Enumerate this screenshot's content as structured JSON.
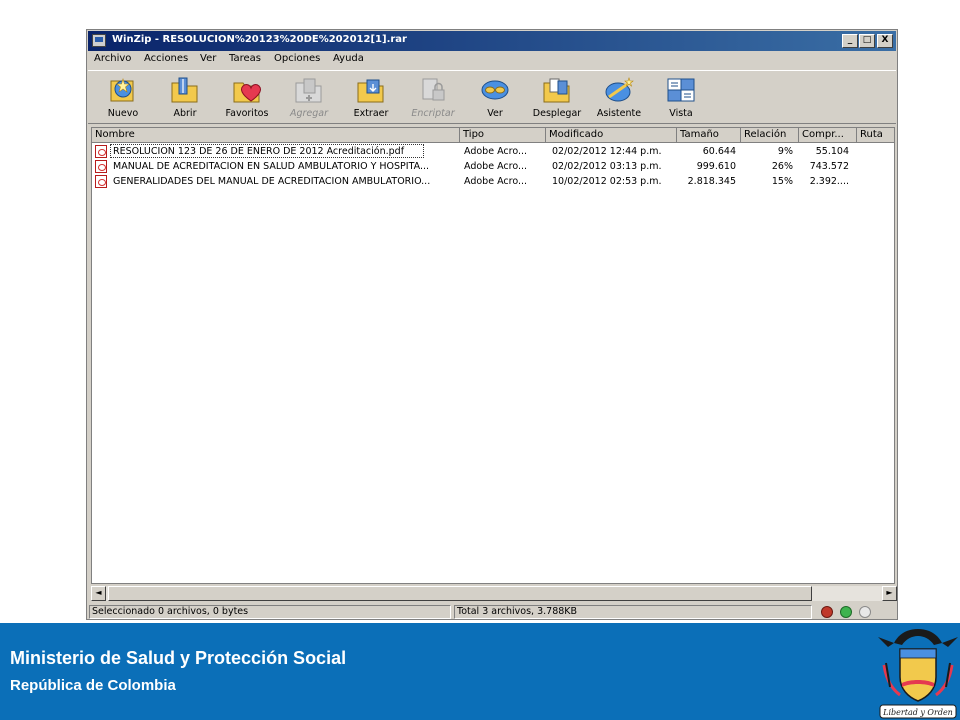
{
  "window": {
    "title": "WinZip - RESOLUCION%20123%20DE%202012[1].rar",
    "controls": {
      "minimize": "_",
      "maximize": "□",
      "close": "X"
    }
  },
  "menu": [
    "Archivo",
    "Acciones",
    "Ver",
    "Tareas",
    "Opciones",
    "Ayuda"
  ],
  "toolbar": [
    {
      "label": "Nuevo",
      "icon": "new-archive-icon",
      "enabled": true
    },
    {
      "label": "Abrir",
      "icon": "open-folder-icon",
      "enabled": true
    },
    {
      "label": "Favoritos",
      "icon": "favorites-heart-icon",
      "enabled": true
    },
    {
      "label": "Agregar",
      "icon": "add-files-icon",
      "enabled": false
    },
    {
      "label": "Extraer",
      "icon": "extract-icon",
      "enabled": true
    },
    {
      "label": "Encriptar",
      "icon": "encrypt-icon",
      "enabled": false
    },
    {
      "label": "Ver",
      "icon": "view-glasses-icon",
      "enabled": true
    },
    {
      "label": "Desplegar",
      "icon": "checkout-icon",
      "enabled": true
    },
    {
      "label": "Asistente",
      "icon": "wizard-icon",
      "enabled": true
    },
    {
      "label": "Vista",
      "icon": "view-style-icon",
      "enabled": true
    }
  ],
  "columns": [
    "Nombre",
    "Tipo",
    "Modificado",
    "Tamaño",
    "Relación",
    "Compr...",
    "Ruta"
  ],
  "files": [
    {
      "name": "RESOLUCION 123 DE 26 DE ENERO DE 2012 Acreditación.pdf",
      "type": "Adobe Acro...",
      "modified": "02/02/2012 12:44 p.m.",
      "size": "60.644",
      "ratio": "9%",
      "packed": "55.104",
      "path": ""
    },
    {
      "name": "MANUAL DE ACREDITACION EN SALUD AMBULATORIO Y HOSPITA...",
      "type": "Adobe Acro...",
      "modified": "02/02/2012 03:13 p.m.",
      "size": "999.610",
      "ratio": "26%",
      "packed": "743.572",
      "path": ""
    },
    {
      "name": "GENERALIDADES DEL MANUAL DE ACREDITACIÓN AMBULATORIO...",
      "type": "Adobe Acro...",
      "modified": "10/02/2012 02:53 p.m.",
      "size": "2.818.345",
      "ratio": "15%",
      "packed": "2.392....",
      "path": ""
    }
  ],
  "scrollbar": {
    "left": "◄",
    "right": "►"
  },
  "status": {
    "selected": "Seleccionado 0 archivos, 0 bytes",
    "total": "Total 3 archivos, 3.788KB"
  },
  "footer": {
    "line1": "Ministerio de Salud y  Protección Social",
    "line2": "República de Colombia",
    "emblem_text": "Libertad y Orden"
  },
  "colors": {
    "titlebar_start": "#0a246a",
    "titlebar_end": "#3a6ea5",
    "window_face": "#d4d0c8",
    "footer_blue": "#0b6fb8"
  }
}
